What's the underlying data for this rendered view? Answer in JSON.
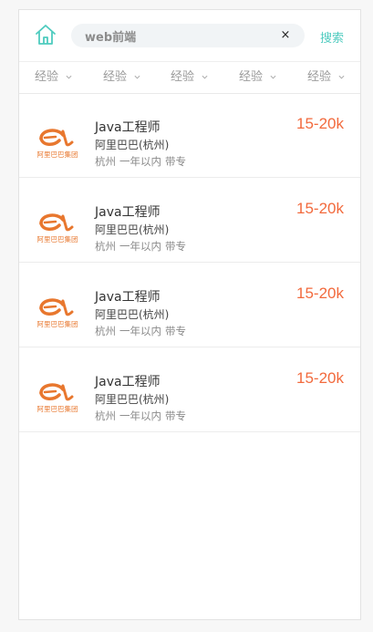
{
  "header": {
    "search_value": "web前端",
    "clear_label": "×",
    "search_button": "搜索"
  },
  "filters": [
    {
      "label": "经验"
    },
    {
      "label": "经验"
    },
    {
      "label": "经验"
    },
    {
      "label": "经验"
    },
    {
      "label": "经验"
    }
  ],
  "jobs": [
    {
      "title": "Java工程师",
      "company": "阿里巴巴(杭州)",
      "city": "杭州",
      "experience": "一年以内",
      "education": "带专",
      "salary": "15-20k",
      "logo_text": "阿里巴巴集团"
    },
    {
      "title": "Java工程师",
      "company": "阿里巴巴(杭州)",
      "city": "杭州",
      "experience": "一年以内",
      "education": "带专",
      "salary": "15-20k",
      "logo_text": "阿里巴巴集团"
    },
    {
      "title": "Java工程师",
      "company": "阿里巴巴(杭州)",
      "city": "杭州",
      "experience": "一年以内",
      "education": "带专",
      "salary": "15-20k",
      "logo_text": "阿里巴巴集团"
    },
    {
      "title": "Java工程师",
      "company": "阿里巴巴(杭州)",
      "city": "杭州",
      "experience": "一年以内",
      "education": "带专",
      "salary": "15-20k",
      "logo_text": "阿里巴巴集团"
    }
  ],
  "colors": {
    "accent": "#4ecbbf",
    "salary": "#f26a3d",
    "logo": "#e8772e"
  },
  "icons": {
    "home": "home-icon",
    "clear": "close-icon",
    "filter_chevron": "chevron-down-icon"
  }
}
